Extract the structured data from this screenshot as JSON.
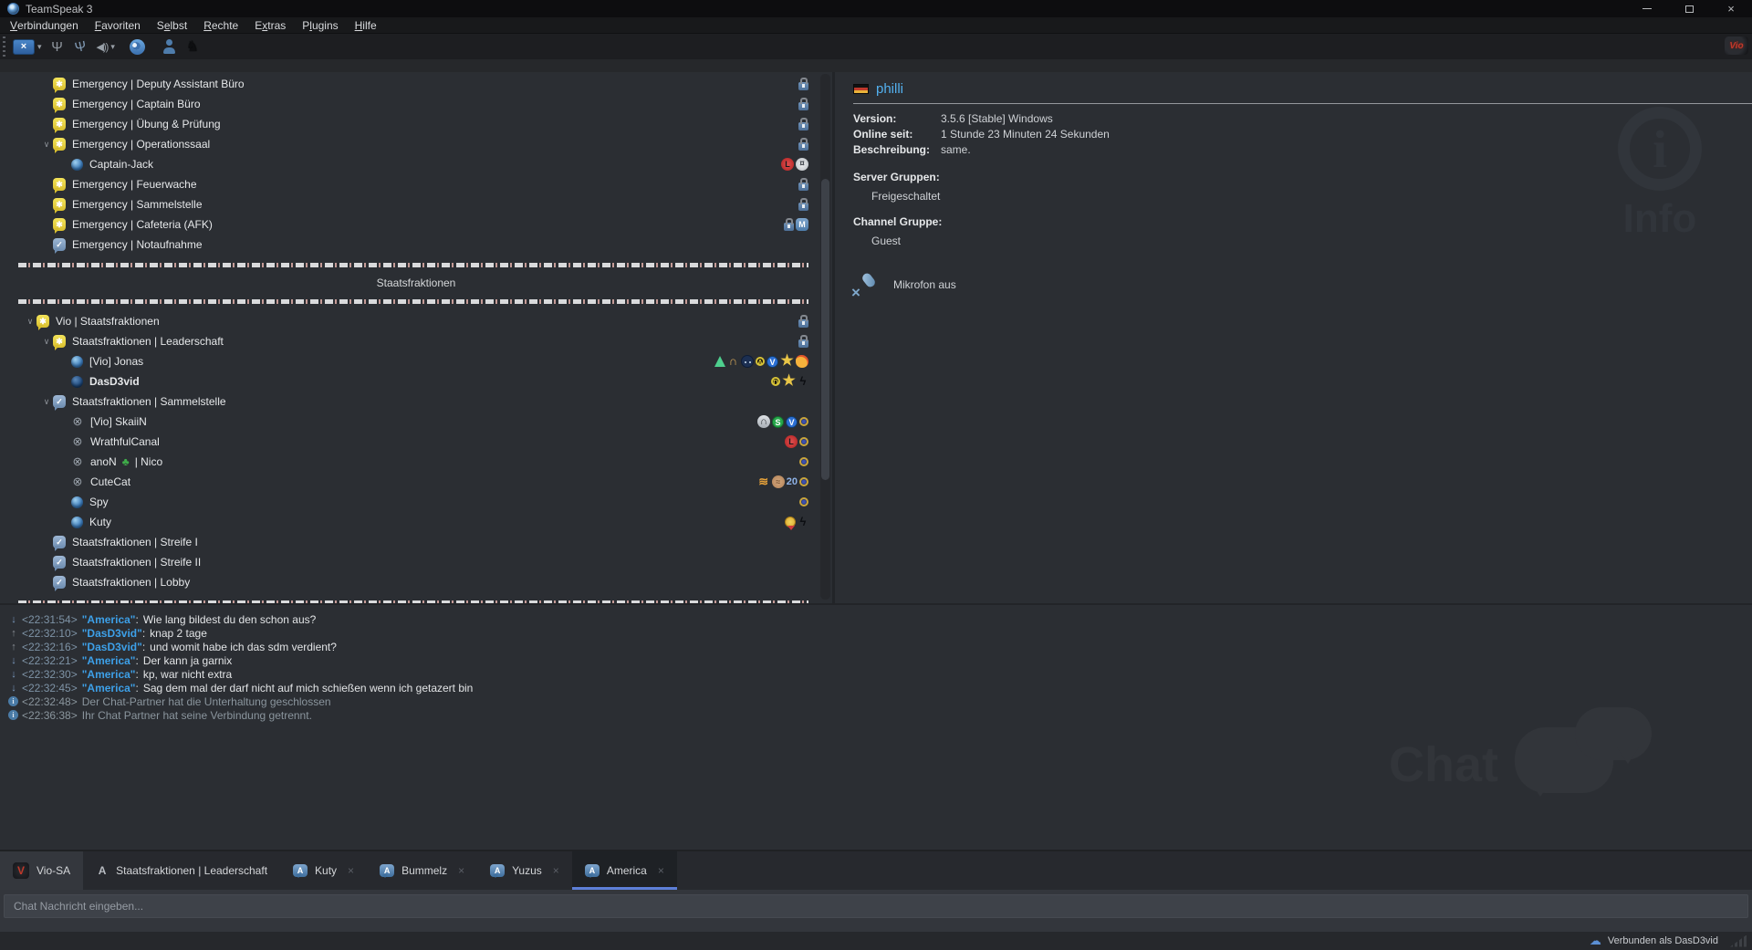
{
  "window": {
    "title": "TeamSpeak 3"
  },
  "menu": {
    "items": [
      {
        "label": "Verbindungen",
        "u": 0
      },
      {
        "label": "Favoriten",
        "u": 0
      },
      {
        "label": "Selbst",
        "u": 1
      },
      {
        "label": "Rechte",
        "u": 0
      },
      {
        "label": "Extras",
        "u": 1
      },
      {
        "label": "Plugins",
        "u": 1
      },
      {
        "label": "Hilfe",
        "u": 0
      }
    ]
  },
  "toolbar": {
    "buttons": [
      "disconnect",
      "disconnect-dropdown",
      "toggle-away",
      "mute-microphone",
      "mute-speakers",
      "mute-speakers-dropdown",
      "status-bubble",
      "client-info",
      "plugin-wolf"
    ],
    "server_logo": "Vio"
  },
  "tree": {
    "rows": [
      {
        "k": "channel",
        "d": 2,
        "i": "channel-yellow",
        "t": "Emergency | Deputy Assistant Büro",
        "r": [
          "padlock"
        ]
      },
      {
        "k": "channel",
        "d": 2,
        "i": "channel-yellow",
        "t": "Emergency | Captain Büro",
        "r": [
          "padlock"
        ]
      },
      {
        "k": "channel",
        "d": 2,
        "i": "channel-yellow",
        "t": "Emergency | Übung & Prüfung",
        "r": [
          "padlock"
        ]
      },
      {
        "k": "channel",
        "d": 2,
        "i": "channel-yellow",
        "x": true,
        "t": "Emergency | Operationssaal",
        "r": [
          "padlock"
        ]
      },
      {
        "k": "user",
        "d": 3,
        "i": "sphere",
        "t": "Captain-Jack",
        "r": [
          "red-l",
          "eagle"
        ]
      },
      {
        "k": "channel",
        "d": 2,
        "i": "channel-yellow",
        "t": "Emergency | Feuerwache",
        "r": [
          "padlock"
        ]
      },
      {
        "k": "channel",
        "d": 2,
        "i": "channel-yellow",
        "t": "Emergency | Sammelstelle",
        "r": [
          "padlock"
        ]
      },
      {
        "k": "channel",
        "d": 2,
        "i": "channel-yellow",
        "t": "Emergency | Cafeteria (AFK)",
        "r": [
          "padlock",
          "m-bubble"
        ]
      },
      {
        "k": "channel",
        "d": 2,
        "i": "channel-blue",
        "t": "Emergency | Notaufnahme",
        "r": []
      },
      {
        "k": "spacer"
      },
      {
        "k": "header",
        "t": "Staatsfraktionen"
      },
      {
        "k": "spacer"
      },
      {
        "k": "channel",
        "d": 1,
        "i": "channel-yellow",
        "x": true,
        "t": "Vio | Staatsfraktionen",
        "r": [
          "padlock"
        ]
      },
      {
        "k": "channel",
        "d": 2,
        "i": "channel-yellow",
        "x": true,
        "t": "Staatsfraktionen | Leaderschaft",
        "r": [
          "padlock"
        ]
      },
      {
        "k": "user",
        "d": 3,
        "i": "sphere",
        "t": "[Vio] Jonas",
        "r": [
          "flask",
          "headset",
          "ninja",
          "circle-a",
          "circle-v",
          "star",
          "charmander"
        ]
      },
      {
        "k": "user",
        "d": 3,
        "i": "sphere-dark",
        "t": "DasD3vid",
        "b": true,
        "r": [
          "circle-d",
          "star",
          "wolf"
        ]
      },
      {
        "k": "channel",
        "d": 2,
        "i": "channel-blue",
        "x": true,
        "t": "Staatsfraktionen | Sammelstelle",
        "r": []
      },
      {
        "k": "user",
        "d": 3,
        "i": "mic-muted",
        "t": "[Vio] SkaiiN",
        "r": [
          "hex-headset",
          "circle-s",
          "circle-v",
          "fbi-seal"
        ]
      },
      {
        "k": "user",
        "d": 3,
        "i": "mic-muted",
        "t": "WrathfulCanal",
        "r": [
          "red-l",
          "fbi-seal"
        ]
      },
      {
        "k": "user",
        "d": 3,
        "i": "mic-muted",
        "t": "anoN",
        "m": "clover",
        "s": "| Nico",
        "r": [
          "fbi-seal"
        ]
      },
      {
        "k": "user",
        "d": 3,
        "i": "mic-muted",
        "t": "CuteCat",
        "r": [
          "waveform",
          "brain",
          "badge-20",
          "fbi-seal"
        ]
      },
      {
        "k": "user",
        "d": 3,
        "i": "sphere",
        "t": "Spy",
        "r": [
          "fbi-seal"
        ]
      },
      {
        "k": "user",
        "d": 3,
        "i": "sphere",
        "t": "Kuty",
        "r": [
          "medal",
          "wolf"
        ]
      },
      {
        "k": "channel",
        "d": 2,
        "i": "channel-blue",
        "t": "Staatsfraktionen | Streife I",
        "r": []
      },
      {
        "k": "channel",
        "d": 2,
        "i": "channel-blue",
        "t": "Staatsfraktionen | Streife II",
        "r": []
      },
      {
        "k": "channel",
        "d": 2,
        "i": "channel-blue",
        "t": "Staatsfraktionen | Lobby",
        "r": []
      },
      {
        "k": "spacer"
      }
    ]
  },
  "info_panel": {
    "nickname": "philli",
    "flag": "germany-flag",
    "fields": [
      {
        "label": "Version:",
        "value": "3.5.6 [Stable] Windows"
      },
      {
        "label": "Online seit:",
        "value": "1 Stunde 23 Minuten 24 Sekunden"
      },
      {
        "label": "Beschreibung:",
        "value": "same."
      }
    ],
    "server_groups_label": "Server Gruppen:",
    "server_group": "Freigeschaltet",
    "channel_group_label": "Channel Gruppe:",
    "channel_group": "Guest",
    "mic_status": "Mikrofon aus",
    "watermark": "Info"
  },
  "chat": {
    "watermark": "Chat",
    "messages": [
      {
        "dir": "in",
        "time": "<22:31:54>",
        "name": "America",
        "text": "Wie lang bildest du den schon aus?"
      },
      {
        "dir": "out",
        "time": "<22:32:10>",
        "name": "DasD3vid",
        "text": "knap 2 tage"
      },
      {
        "dir": "out",
        "time": "<22:32:16>",
        "name": "DasD3vid",
        "text": "und womit habe ich das sdm verdient?"
      },
      {
        "dir": "in",
        "time": "<22:32:21>",
        "name": "America",
        "text": "Der kann ja garnix"
      },
      {
        "dir": "in",
        "time": "<22:32:30>",
        "name": "America",
        "text": "kp, war nicht extra"
      },
      {
        "dir": "in",
        "time": "<22:32:45>",
        "name": "America",
        "text": "Sag dem mal der darf nicht auf mich schießen wenn ich getazert bin"
      },
      {
        "dir": "sys",
        "time": "<22:32:48>",
        "text": "Der Chat-Partner hat die Unterhaltung geschlossen"
      },
      {
        "dir": "sys",
        "time": "<22:36:38>",
        "text": "Ihr Chat Partner hat seine Verbindung getrennt."
      }
    ]
  },
  "tabs": {
    "items": [
      {
        "icon": "vio-logo",
        "label": "Vio-SA",
        "closable": false,
        "active": false,
        "first": true
      },
      {
        "icon": "letter-a",
        "label": "Staatsfraktionen | Leaderschaft",
        "closable": false,
        "active": false
      },
      {
        "icon": "chat-bubble-a",
        "label": "Kuty",
        "closable": true,
        "active": false
      },
      {
        "icon": "chat-bubble-a",
        "label": "Bummelz",
        "closable": true,
        "active": false
      },
      {
        "icon": "chat-bubble-a",
        "label": "Yuzus",
        "closable": true,
        "active": false
      },
      {
        "icon": "chat-bubble-a",
        "label": "America",
        "closable": true,
        "active": true
      }
    ]
  },
  "chat_input": {
    "placeholder": "Chat Nachricht eingeben..."
  },
  "status_bar": {
    "connection": "Verbunden als DasD3vid",
    "icons": [
      "cloud",
      "wifi-signal"
    ]
  }
}
